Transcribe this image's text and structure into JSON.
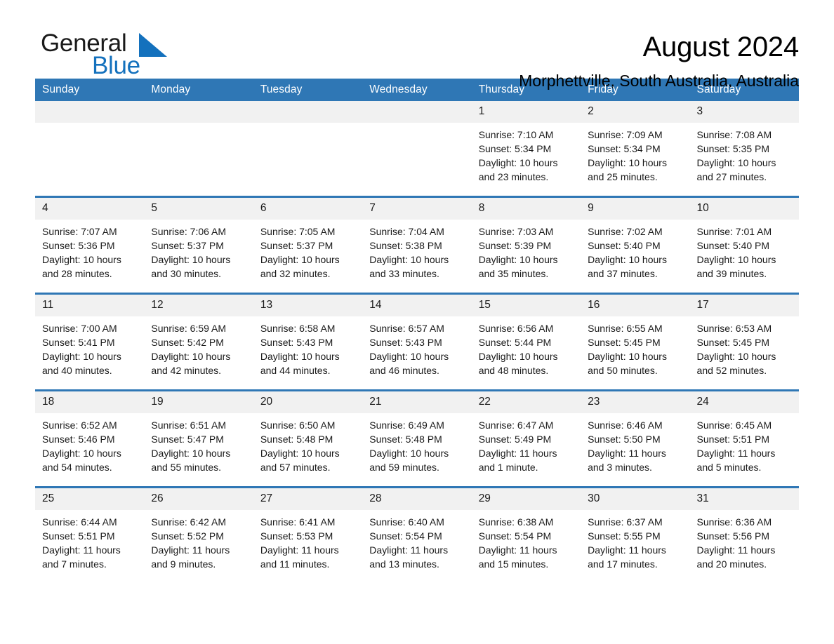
{
  "brand": {
    "name_part1": "General",
    "name_part2": "Blue",
    "accent_color": "#1471bd"
  },
  "header": {
    "title": "August 2024",
    "location": "Morphettville, South Australia, Australia"
  },
  "theme": {
    "header_blue": "#2f77b5",
    "daynum_band": "#f1f1f1"
  },
  "weekday_headers": [
    "Sunday",
    "Monday",
    "Tuesday",
    "Wednesday",
    "Thursday",
    "Friday",
    "Saturday"
  ],
  "labels": {
    "sunrise_prefix": "Sunrise:",
    "sunset_prefix": "Sunset:",
    "daylight_prefix": "Daylight:"
  },
  "weeks": [
    [
      {
        "day": "",
        "sunrise": "",
        "sunset": "",
        "daylight": ""
      },
      {
        "day": "",
        "sunrise": "",
        "sunset": "",
        "daylight": ""
      },
      {
        "day": "",
        "sunrise": "",
        "sunset": "",
        "daylight": ""
      },
      {
        "day": "",
        "sunrise": "",
        "sunset": "",
        "daylight": ""
      },
      {
        "day": "1",
        "sunrise": "Sunrise: 7:10 AM",
        "sunset": "Sunset: 5:34 PM",
        "daylight": "Daylight: 10 hours and 23 minutes."
      },
      {
        "day": "2",
        "sunrise": "Sunrise: 7:09 AM",
        "sunset": "Sunset: 5:34 PM",
        "daylight": "Daylight: 10 hours and 25 minutes."
      },
      {
        "day": "3",
        "sunrise": "Sunrise: 7:08 AM",
        "sunset": "Sunset: 5:35 PM",
        "daylight": "Daylight: 10 hours and 27 minutes."
      }
    ],
    [
      {
        "day": "4",
        "sunrise": "Sunrise: 7:07 AM",
        "sunset": "Sunset: 5:36 PM",
        "daylight": "Daylight: 10 hours and 28 minutes."
      },
      {
        "day": "5",
        "sunrise": "Sunrise: 7:06 AM",
        "sunset": "Sunset: 5:37 PM",
        "daylight": "Daylight: 10 hours and 30 minutes."
      },
      {
        "day": "6",
        "sunrise": "Sunrise: 7:05 AM",
        "sunset": "Sunset: 5:37 PM",
        "daylight": "Daylight: 10 hours and 32 minutes."
      },
      {
        "day": "7",
        "sunrise": "Sunrise: 7:04 AM",
        "sunset": "Sunset: 5:38 PM",
        "daylight": "Daylight: 10 hours and 33 minutes."
      },
      {
        "day": "8",
        "sunrise": "Sunrise: 7:03 AM",
        "sunset": "Sunset: 5:39 PM",
        "daylight": "Daylight: 10 hours and 35 minutes."
      },
      {
        "day": "9",
        "sunrise": "Sunrise: 7:02 AM",
        "sunset": "Sunset: 5:40 PM",
        "daylight": "Daylight: 10 hours and 37 minutes."
      },
      {
        "day": "10",
        "sunrise": "Sunrise: 7:01 AM",
        "sunset": "Sunset: 5:40 PM",
        "daylight": "Daylight: 10 hours and 39 minutes."
      }
    ],
    [
      {
        "day": "11",
        "sunrise": "Sunrise: 7:00 AM",
        "sunset": "Sunset: 5:41 PM",
        "daylight": "Daylight: 10 hours and 40 minutes."
      },
      {
        "day": "12",
        "sunrise": "Sunrise: 6:59 AM",
        "sunset": "Sunset: 5:42 PM",
        "daylight": "Daylight: 10 hours and 42 minutes."
      },
      {
        "day": "13",
        "sunrise": "Sunrise: 6:58 AM",
        "sunset": "Sunset: 5:43 PM",
        "daylight": "Daylight: 10 hours and 44 minutes."
      },
      {
        "day": "14",
        "sunrise": "Sunrise: 6:57 AM",
        "sunset": "Sunset: 5:43 PM",
        "daylight": "Daylight: 10 hours and 46 minutes."
      },
      {
        "day": "15",
        "sunrise": "Sunrise: 6:56 AM",
        "sunset": "Sunset: 5:44 PM",
        "daylight": "Daylight: 10 hours and 48 minutes."
      },
      {
        "day": "16",
        "sunrise": "Sunrise: 6:55 AM",
        "sunset": "Sunset: 5:45 PM",
        "daylight": "Daylight: 10 hours and 50 minutes."
      },
      {
        "day": "17",
        "sunrise": "Sunrise: 6:53 AM",
        "sunset": "Sunset: 5:45 PM",
        "daylight": "Daylight: 10 hours and 52 minutes."
      }
    ],
    [
      {
        "day": "18",
        "sunrise": "Sunrise: 6:52 AM",
        "sunset": "Sunset: 5:46 PM",
        "daylight": "Daylight: 10 hours and 54 minutes."
      },
      {
        "day": "19",
        "sunrise": "Sunrise: 6:51 AM",
        "sunset": "Sunset: 5:47 PM",
        "daylight": "Daylight: 10 hours and 55 minutes."
      },
      {
        "day": "20",
        "sunrise": "Sunrise: 6:50 AM",
        "sunset": "Sunset: 5:48 PM",
        "daylight": "Daylight: 10 hours and 57 minutes."
      },
      {
        "day": "21",
        "sunrise": "Sunrise: 6:49 AM",
        "sunset": "Sunset: 5:48 PM",
        "daylight": "Daylight: 10 hours and 59 minutes."
      },
      {
        "day": "22",
        "sunrise": "Sunrise: 6:47 AM",
        "sunset": "Sunset: 5:49 PM",
        "daylight": "Daylight: 11 hours and 1 minute."
      },
      {
        "day": "23",
        "sunrise": "Sunrise: 6:46 AM",
        "sunset": "Sunset: 5:50 PM",
        "daylight": "Daylight: 11 hours and 3 minutes."
      },
      {
        "day": "24",
        "sunrise": "Sunrise: 6:45 AM",
        "sunset": "Sunset: 5:51 PM",
        "daylight": "Daylight: 11 hours and 5 minutes."
      }
    ],
    [
      {
        "day": "25",
        "sunrise": "Sunrise: 6:44 AM",
        "sunset": "Sunset: 5:51 PM",
        "daylight": "Daylight: 11 hours and 7 minutes."
      },
      {
        "day": "26",
        "sunrise": "Sunrise: 6:42 AM",
        "sunset": "Sunset: 5:52 PM",
        "daylight": "Daylight: 11 hours and 9 minutes."
      },
      {
        "day": "27",
        "sunrise": "Sunrise: 6:41 AM",
        "sunset": "Sunset: 5:53 PM",
        "daylight": "Daylight: 11 hours and 11 minutes."
      },
      {
        "day": "28",
        "sunrise": "Sunrise: 6:40 AM",
        "sunset": "Sunset: 5:54 PM",
        "daylight": "Daylight: 11 hours and 13 minutes."
      },
      {
        "day": "29",
        "sunrise": "Sunrise: 6:38 AM",
        "sunset": "Sunset: 5:54 PM",
        "daylight": "Daylight: 11 hours and 15 minutes."
      },
      {
        "day": "30",
        "sunrise": "Sunrise: 6:37 AM",
        "sunset": "Sunset: 5:55 PM",
        "daylight": "Daylight: 11 hours and 17 minutes."
      },
      {
        "day": "31",
        "sunrise": "Sunrise: 6:36 AM",
        "sunset": "Sunset: 5:56 PM",
        "daylight": "Daylight: 11 hours and 20 minutes."
      }
    ]
  ]
}
